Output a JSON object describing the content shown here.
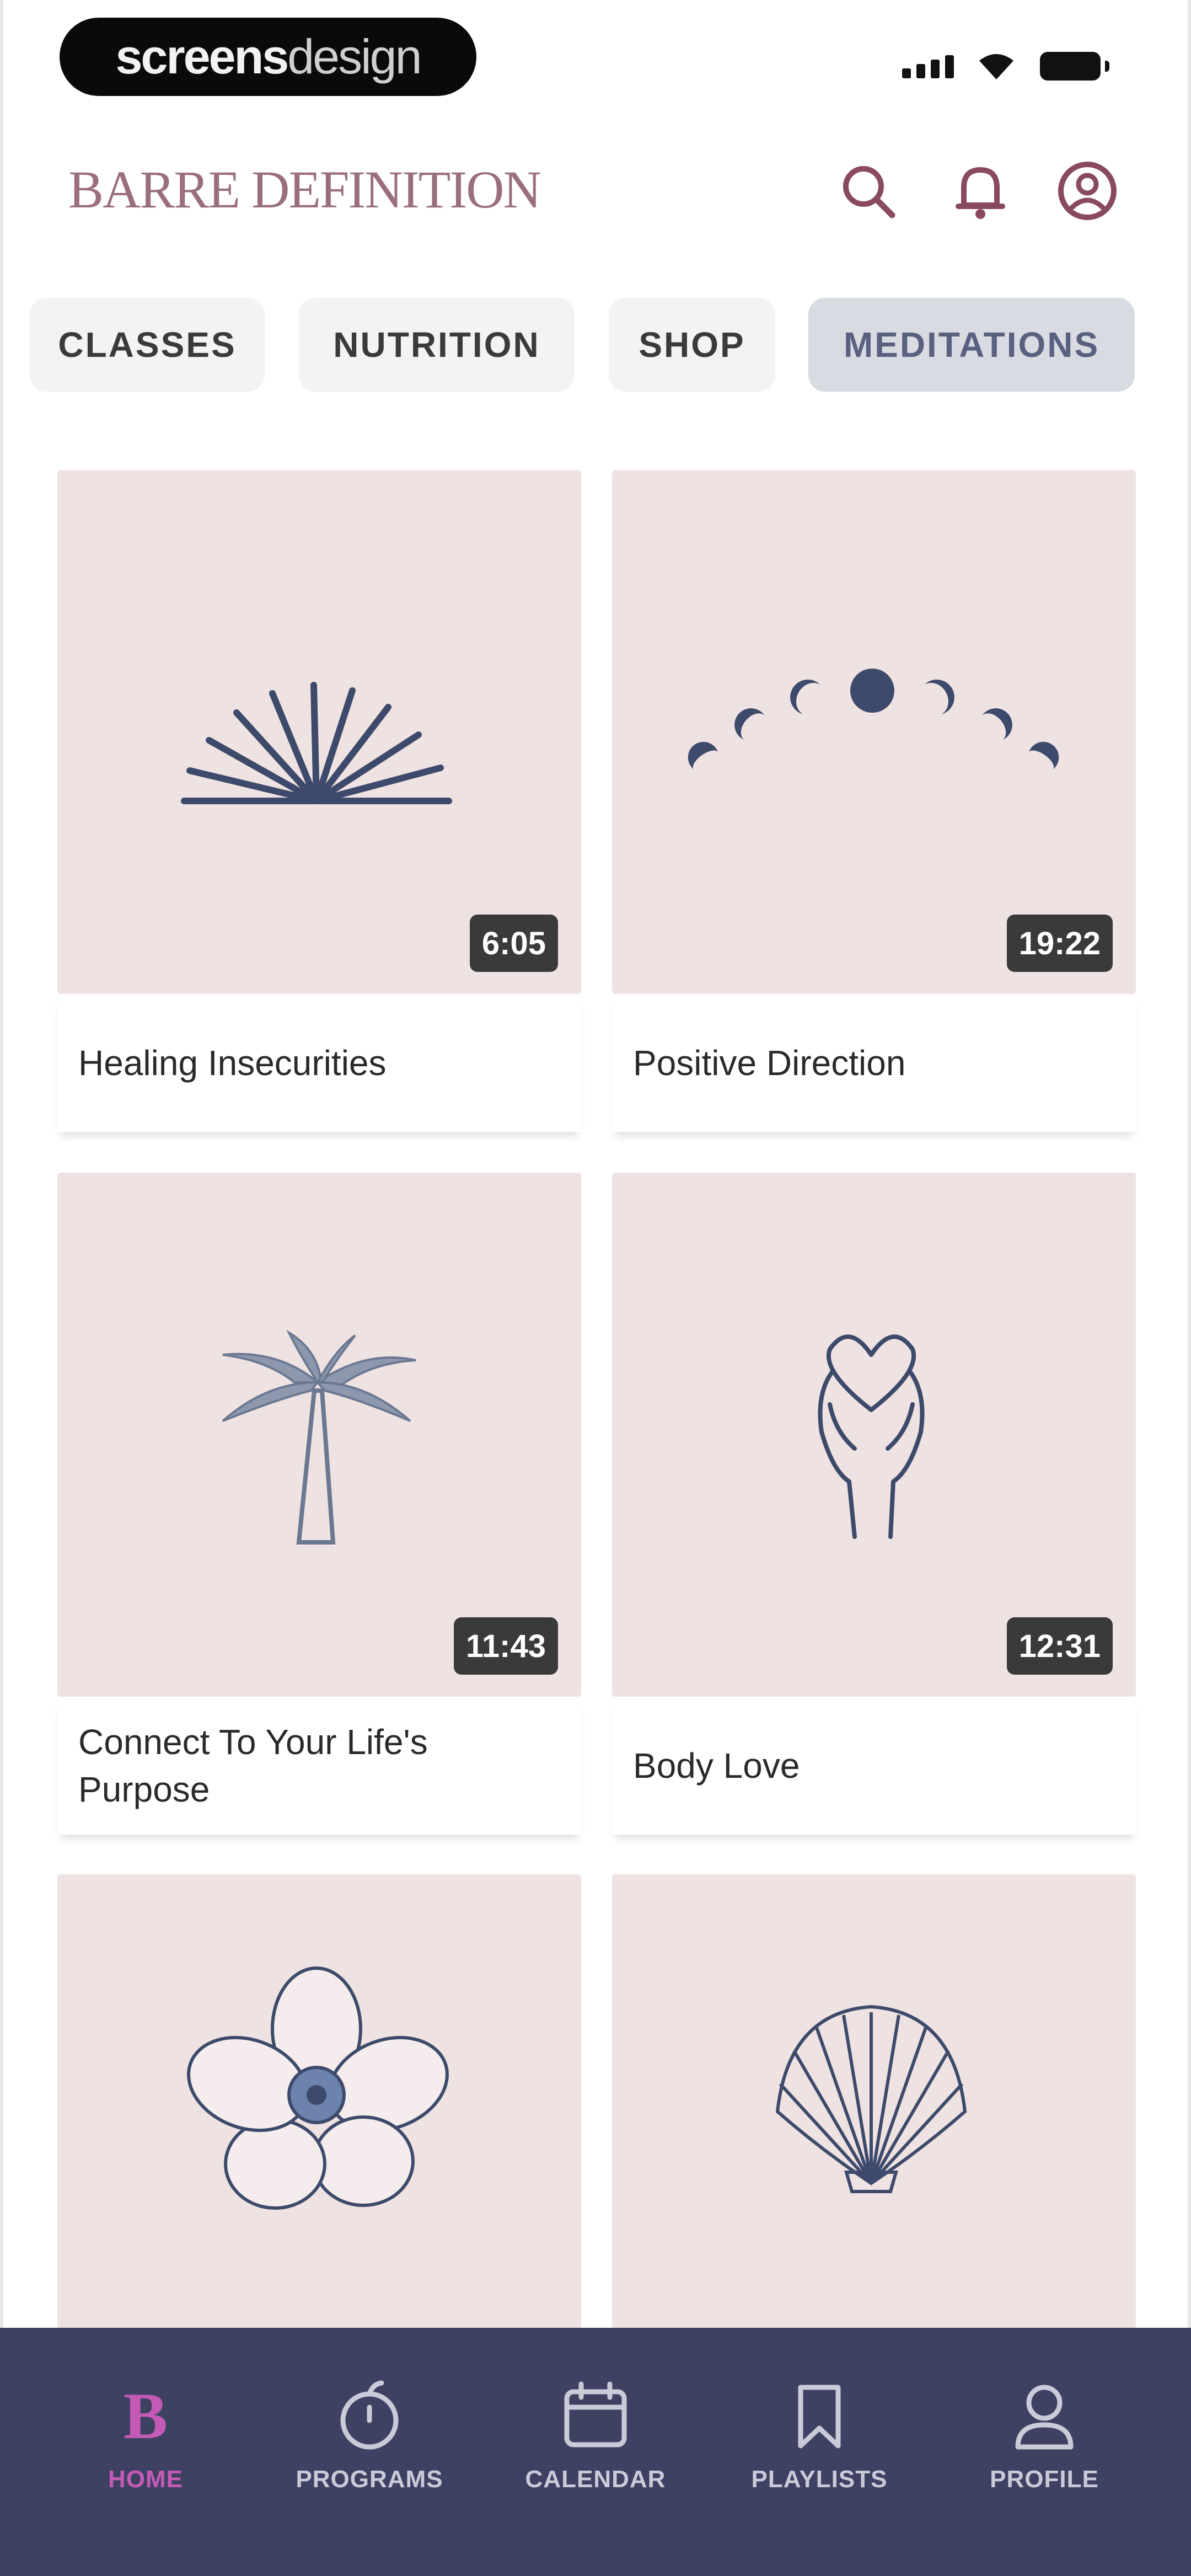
{
  "status_bar": {
    "brand_bold": "screens",
    "brand_light": "design"
  },
  "header": {
    "title": "BARRE DEFINITION",
    "icons": [
      "search-icon",
      "bell-icon",
      "profile-circle-icon"
    ]
  },
  "tabs": [
    {
      "label": "CLASSES",
      "active": false
    },
    {
      "label": "NUTRITION",
      "active": false
    },
    {
      "label": "SHOP",
      "active": false
    },
    {
      "label": "MEDITATIONS",
      "active": true
    }
  ],
  "meditations": [
    {
      "title": "Healing Insecurities",
      "duration": "6:05",
      "art": "palm-fan-icon"
    },
    {
      "title": "Positive Direction",
      "duration": "19:22",
      "art": "moon-phases-icon"
    },
    {
      "title": "Connect To Your Life's Purpose",
      "duration": "11:43",
      "art": "palm-tree-icon"
    },
    {
      "title": "Body Love",
      "duration": "12:31",
      "art": "hands-heart-icon"
    },
    {
      "title": "",
      "duration": "",
      "art": "flower-icon"
    },
    {
      "title": "",
      "duration": "",
      "art": "seashell-icon"
    }
  ],
  "bottom_nav": [
    {
      "label": "HOME",
      "icon": "home-logo-icon",
      "active": true
    },
    {
      "label": "PROGRAMS",
      "icon": "programs-icon",
      "active": false
    },
    {
      "label": "CALENDAR",
      "icon": "calendar-icon",
      "active": false
    },
    {
      "label": "PLAYLISTS",
      "icon": "bookmark-icon",
      "active": false
    },
    {
      "label": "PROFILE",
      "icon": "person-icon",
      "active": false
    }
  ],
  "colors": {
    "accent": "#9a6e7f",
    "card_bg": "#efe2e2",
    "art": "#3d4a6b",
    "nav_bg": "#3f4163",
    "nav_active": "#c55ab6"
  }
}
